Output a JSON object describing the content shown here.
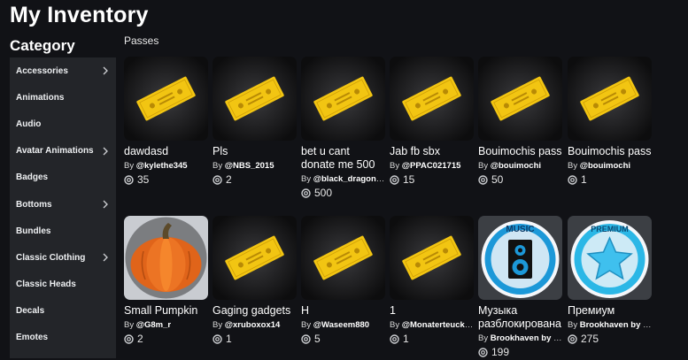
{
  "page": {
    "title": "My Inventory"
  },
  "sidebar": {
    "heading": "Category",
    "items": [
      {
        "label": "Accessories",
        "has_submenu": true
      },
      {
        "label": "Animations",
        "has_submenu": false
      },
      {
        "label": "Audio",
        "has_submenu": false
      },
      {
        "label": "Avatar Animations",
        "has_submenu": true
      },
      {
        "label": "Badges",
        "has_submenu": false
      },
      {
        "label": "Bottoms",
        "has_submenu": true
      },
      {
        "label": "Bundles",
        "has_submenu": false
      },
      {
        "label": "Classic Clothing",
        "has_submenu": true
      },
      {
        "label": "Classic Heads",
        "has_submenu": false
      },
      {
        "label": "Decals",
        "has_submenu": false
      },
      {
        "label": "Emotes",
        "has_submenu": false
      }
    ]
  },
  "main": {
    "section_label": "Passes",
    "by_prefix": "By",
    "items": [
      {
        "name": "dawdasd",
        "creator": "@kylethe345",
        "price": "35",
        "thumb": "ticket-icon"
      },
      {
        "name": "Pls",
        "creator": "@NBS_2015",
        "price": "2",
        "thumb": "ticket-icon"
      },
      {
        "name": "bet u cant donate me 500",
        "creator": "@black_dragon7…",
        "price": "500",
        "thumb": "ticket-icon"
      },
      {
        "name": "Jab fb sbx",
        "creator": "@PPAC021715",
        "price": "15",
        "thumb": "ticket-icon"
      },
      {
        "name": "Bouimochis pass",
        "creator": "@bouimochi",
        "price": "50",
        "thumb": "ticket-icon"
      },
      {
        "name": "Bouimochis pass",
        "creator": "@bouimochi",
        "price": "1",
        "thumb": "ticket-icon"
      },
      {
        "name": "Small Pumpkin",
        "creator": "@G8m_r",
        "price": "2",
        "thumb": "pumpkin-image"
      },
      {
        "name": "Gaging gadgets",
        "creator": "@xruboxox14",
        "price": "1",
        "thumb": "ticket-icon"
      },
      {
        "name": "H",
        "creator": "@Waseem880",
        "price": "5",
        "thumb": "ticket-icon"
      },
      {
        "name": "1",
        "creator": "@Monaterteuck1…",
        "price": "1",
        "thumb": "ticket-icon"
      },
      {
        "name": "Музыка разблокирована",
        "creator": "Brookhaven by V…",
        "price": "199",
        "thumb": "music-badge-icon",
        "badge_text": "MUSIC"
      },
      {
        "name": "Премиум",
        "creator": "Brookhaven by V…",
        "price": "275",
        "thumb": "premium-badge-icon",
        "badge_text": "PREMIUM"
      }
    ]
  },
  "colors": {
    "background": "#111216",
    "sidebar": "#232529",
    "ticket": "#f2c512",
    "thumb_bg": "#2a2b2f"
  }
}
